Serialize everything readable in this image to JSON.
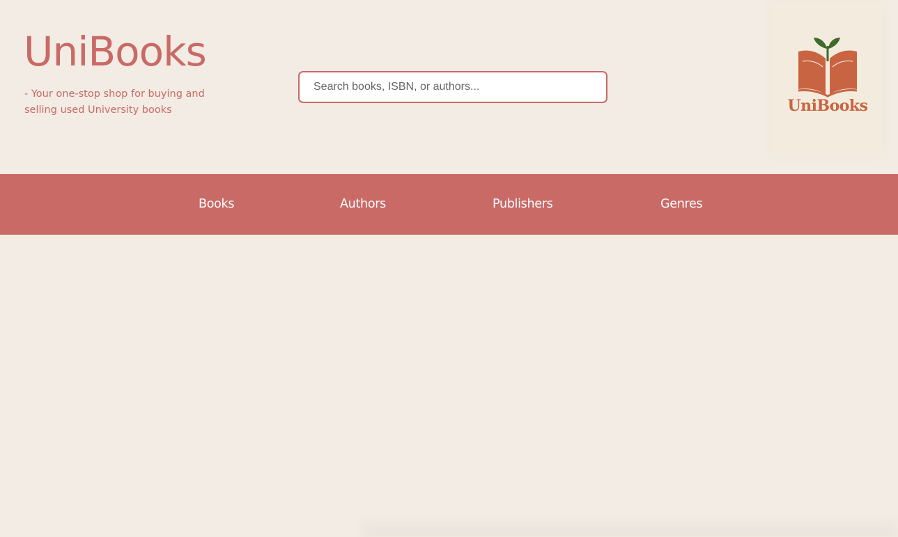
{
  "header": {
    "title": "UniBooks",
    "tagline": "- Your one-stop shop for buying and selling used University books"
  },
  "search": {
    "placeholder": "Search books, ISBN, or authors...",
    "value": ""
  },
  "logo": {
    "text": "UniBooks",
    "icon": "book-sprout-icon"
  },
  "nav": {
    "items": [
      {
        "label": "Books"
      },
      {
        "label": "Authors"
      },
      {
        "label": "Publishers"
      },
      {
        "label": "Genres"
      }
    ]
  },
  "colors": {
    "background": "#f2ece4",
    "accent": "#c96a66",
    "logo_book": "#c96442",
    "logo_leaf": "#3f6b2a",
    "nav_text": "#ffffff"
  }
}
